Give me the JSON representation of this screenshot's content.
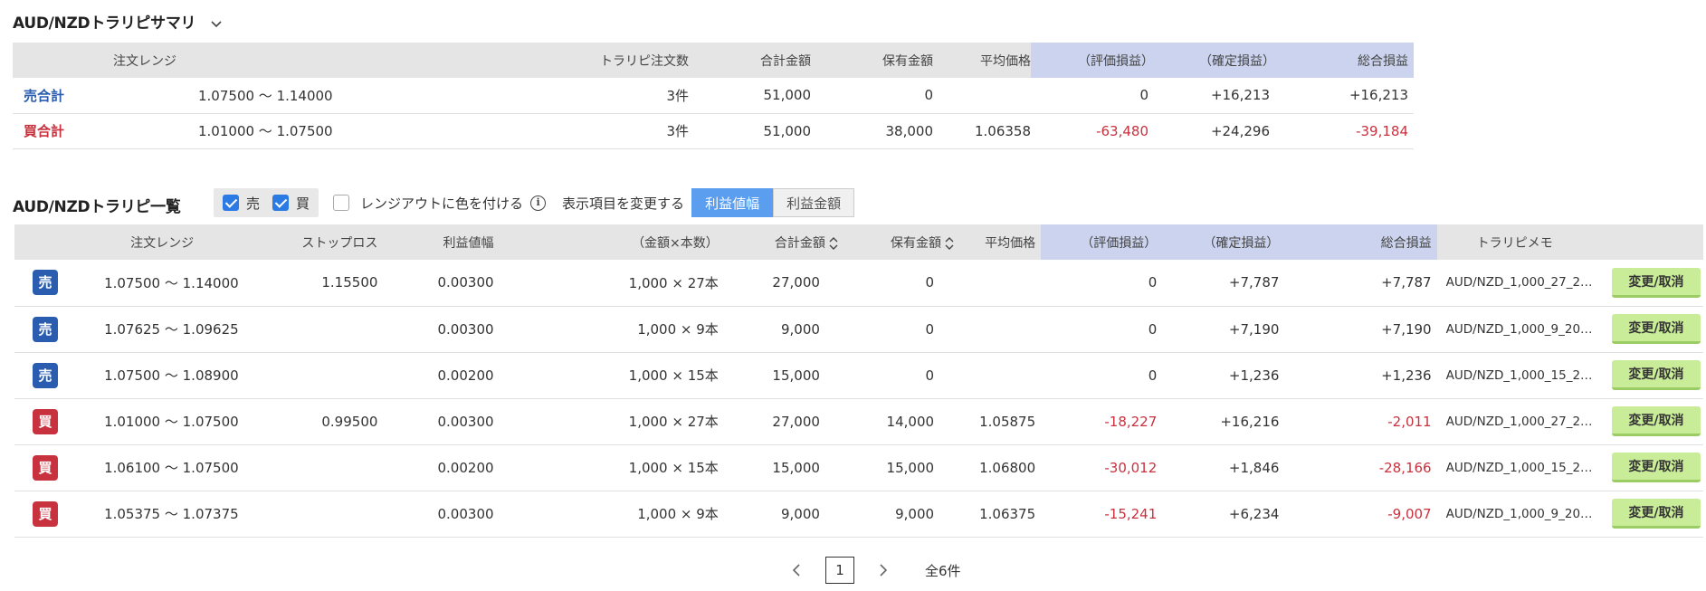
{
  "summary": {
    "title": "AUD/NZDトラリピサマリ",
    "headers": [
      "注文レンジ",
      "トラリピ注文数",
      "合計金額",
      "保有金額",
      "平均価格",
      "（評価損益）",
      "（確定損益）",
      "総合損益"
    ],
    "rows": [
      {
        "label": "売合計",
        "range": "1.07500 〜 1.14000",
        "orders": "3件",
        "total": "51,000",
        "held": "0",
        "avg": "",
        "eval": "0",
        "confirmed": "+16,213",
        "overall": "+16,213"
      },
      {
        "label": "買合計",
        "range": "1.01000 〜 1.07500",
        "orders": "3件",
        "total": "51,000",
        "held": "38,000",
        "avg": "1.06358",
        "eval": "-63,480",
        "confirmed": "+24,296",
        "overall": "-39,184"
      }
    ]
  },
  "list": {
    "title": "AUD/NZDトラリピ一覧",
    "filters": {
      "sell": "売",
      "buy": "買",
      "range_color": "レンジアウトに色を付ける",
      "display_label": "表示項目を変更する"
    },
    "toggle": {
      "active": "利益値幅",
      "inactive": "利益金額"
    },
    "headers": [
      "注文レンジ",
      "ストップロス",
      "利益値幅",
      "（金額×本数）",
      "合計金額",
      "保有金額",
      "平均価格",
      "（評価損益）",
      "（確定損益）",
      "総合損益",
      "トラリピメモ"
    ],
    "rows": [
      {
        "side": "売",
        "range": "1.07500 〜 1.14000",
        "stop": "1.15500",
        "width": "0.00300",
        "qty": "1,000 × 27本",
        "total": "27,000",
        "held": "0",
        "avg": "",
        "eval": "0",
        "confirmed": "+7,787",
        "overall": "+7,787",
        "memo": "AUD/NZD_1,000_27_2…",
        "action": "変更/取消"
      },
      {
        "side": "売",
        "range": "1.07625 〜 1.09625",
        "stop": "",
        "width": "0.00300",
        "qty": "1,000 × 9本",
        "total": "9,000",
        "held": "0",
        "avg": "",
        "eval": "0",
        "confirmed": "+7,190",
        "overall": "+7,190",
        "memo": "AUD/NZD_1,000_9_20…",
        "action": "変更/取消"
      },
      {
        "side": "売",
        "range": "1.07500 〜 1.08900",
        "stop": "",
        "width": "0.00200",
        "qty": "1,000 × 15本",
        "total": "15,000",
        "held": "0",
        "avg": "",
        "eval": "0",
        "confirmed": "+1,236",
        "overall": "+1,236",
        "memo": "AUD/NZD_1,000_15_2…",
        "action": "変更/取消"
      },
      {
        "side": "買",
        "range": "1.01000 〜 1.07500",
        "stop": "0.99500",
        "width": "0.00300",
        "qty": "1,000 × 27本",
        "total": "27,000",
        "held": "14,000",
        "avg": "1.05875",
        "eval": "-18,227",
        "confirmed": "+16,216",
        "overall": "-2,011",
        "memo": "AUD/NZD_1,000_27_2…",
        "action": "変更/取消"
      },
      {
        "side": "買",
        "range": "1.06100 〜 1.07500",
        "stop": "",
        "width": "0.00200",
        "qty": "1,000 × 15本",
        "total": "15,000",
        "held": "15,000",
        "avg": "1.06800",
        "eval": "-30,012",
        "confirmed": "+1,846",
        "overall": "-28,166",
        "memo": "AUD/NZD_1,000_15_2…",
        "action": "変更/取消"
      },
      {
        "side": "買",
        "range": "1.05375 〜 1.07375",
        "stop": "",
        "width": "0.00300",
        "qty": "1,000 × 9本",
        "total": "9,000",
        "held": "9,000",
        "avg": "1.06375",
        "eval": "-15,241",
        "confirmed": "+6,234",
        "overall": "-9,007",
        "memo": "AUD/NZD_1,000_9_20…",
        "action": "変更/取消"
      }
    ]
  },
  "pager": {
    "current": "1",
    "total": "全6件"
  },
  "colors": {
    "sell": "#2a5db0",
    "buy": "#c8323e",
    "negative": "#c8323e",
    "header_bg": "#e5e5e5",
    "header_highlight": "#cbd3ee",
    "action_btn": "#c9ec98",
    "toggle_active": "#5b9ef0"
  }
}
